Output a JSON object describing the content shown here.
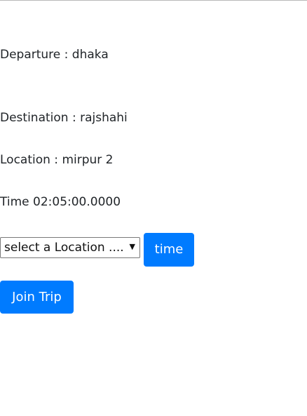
{
  "trip": {
    "departure_label": "Departure : ",
    "departure_value": "dhaka",
    "destination_label": "Destination : ",
    "destination_value": "rajshahi",
    "location_label": "Location : ",
    "location_value": "mirpur 2",
    "time_label": "Time ",
    "time_value": "02:05:00.0000"
  },
  "controls": {
    "location_select_selected": "select a Location ....",
    "location_select_arrow": "▼",
    "time_button_label": "time",
    "join_button_label": "Join Trip"
  },
  "colors": {
    "primary": "#007bff",
    "text": "#212529",
    "background": "#ffffff"
  }
}
